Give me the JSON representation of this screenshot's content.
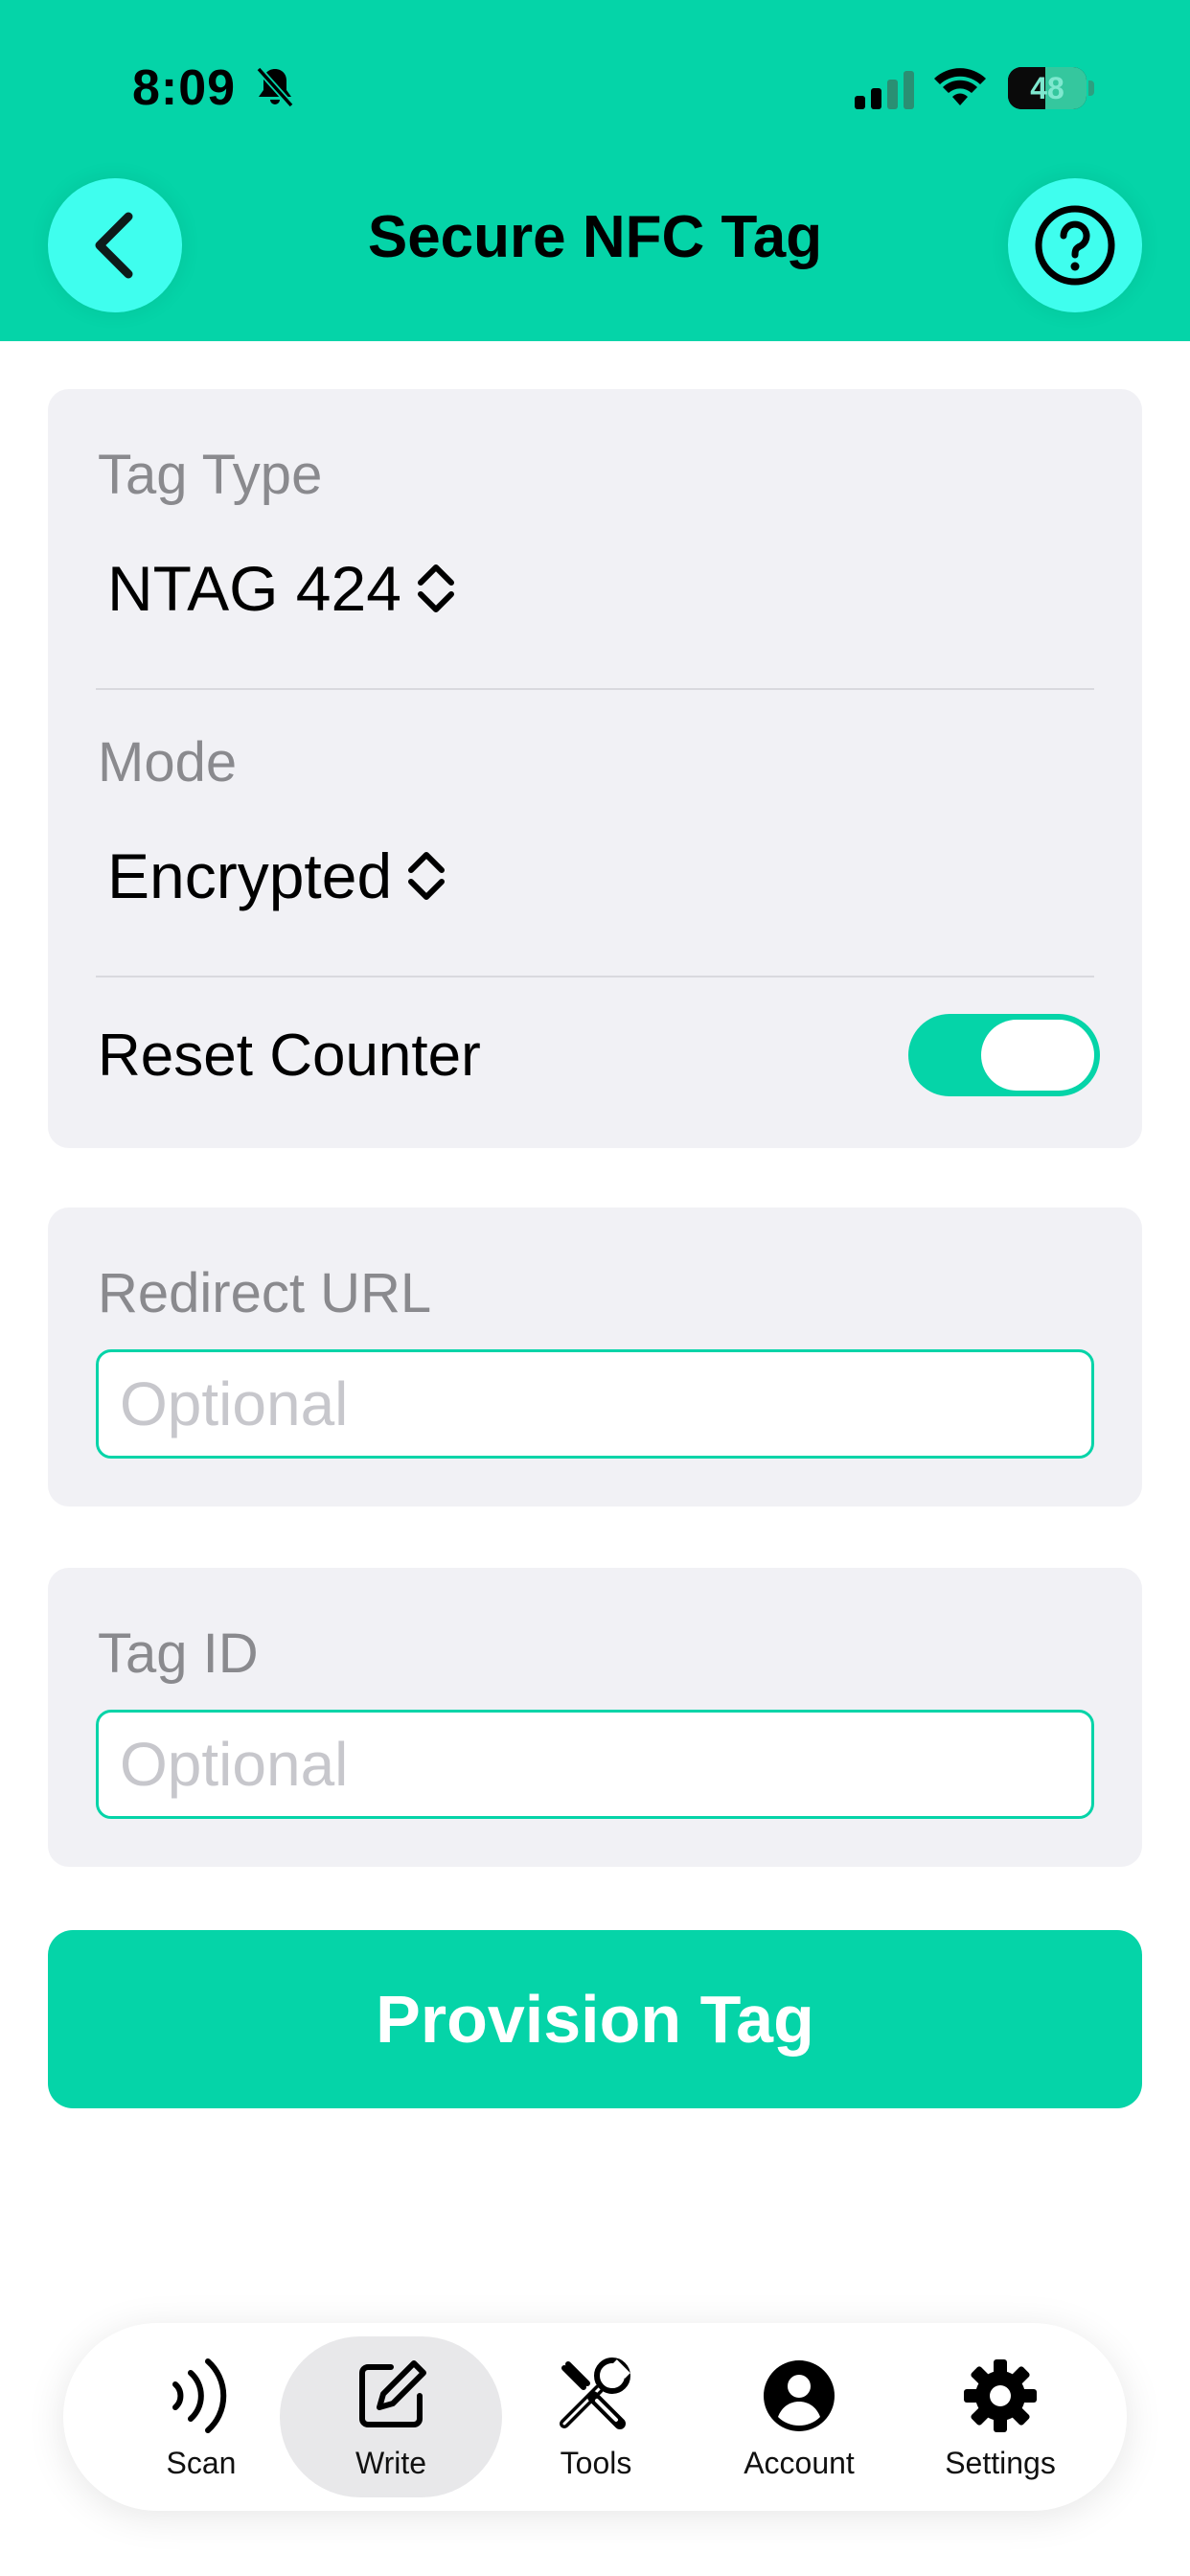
{
  "status_bar": {
    "time": "8:09",
    "battery": "48"
  },
  "header": {
    "title": "Secure NFC Tag",
    "back_icon": "chevron-left-icon",
    "help_icon": "question-circle-icon"
  },
  "form": {
    "tag_type": {
      "label": "Tag Type",
      "value": "NTAG 424"
    },
    "mode": {
      "label": "Mode",
      "value": "Encrypted"
    },
    "reset_counter": {
      "label": "Reset Counter",
      "enabled": true
    },
    "redirect_url": {
      "label": "Redirect URL",
      "placeholder": "Optional",
      "value": ""
    },
    "tag_id": {
      "label": "Tag ID",
      "placeholder": "Optional",
      "value": ""
    }
  },
  "actions": {
    "provision_label": "Provision Tag"
  },
  "tabbar": {
    "active": "write",
    "items": [
      {
        "id": "scan",
        "label": "Scan",
        "icon": "nfc-waves-icon"
      },
      {
        "id": "write",
        "label": "Write",
        "icon": "edit-icon"
      },
      {
        "id": "tools",
        "label": "Tools",
        "icon": "tools-icon"
      },
      {
        "id": "account",
        "label": "Account",
        "icon": "person-circle-icon"
      },
      {
        "id": "settings",
        "label": "Settings",
        "icon": "gear-icon"
      }
    ]
  },
  "colors": {
    "accent": "#05d4a8",
    "round_button": "#3ffeee",
    "card_bg": "#f1f1f5",
    "label_gray": "#8a8a8e"
  }
}
